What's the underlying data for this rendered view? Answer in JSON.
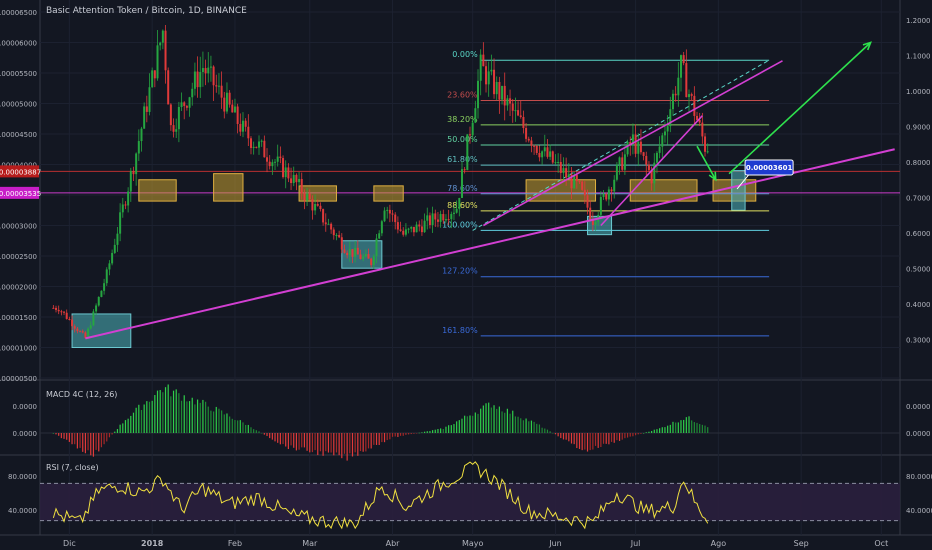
{
  "header": {
    "title": "Basic Attention Token / Bitcoin, 1D, BINANCE"
  },
  "colors": {
    "background": "#131722",
    "up": "#26a641",
    "down": "#e03a3a",
    "fib": "#5ad7c8",
    "trend": "#d23fd2",
    "hline_red": "#b73030",
    "hline_magenta": "#c93cc9",
    "arrow": "#2ee04d",
    "box_yellow": "#c8a030",
    "box_teal": "#4aa8b0",
    "rsi_line": "#f0e040"
  },
  "chart_data": [
    {
      "type": "line",
      "name": "price",
      "series_type": "candlestick",
      "ylim": [
        5e-06,
        6.5e-06
      ],
      "left_axis_ticks": [
        "0.00006500",
        "0.00006000",
        "0.00005500",
        "0.00005000",
        "0.00004500",
        "0.00004000",
        "0.00003500",
        "0.00003000",
        "0.00002500",
        "0.00002000",
        "0.00001500",
        "0.00001000",
        "0.00000500"
      ],
      "right_axis_ticks": [
        "1.2000",
        "1.1000",
        "1.0000",
        "0.9000",
        "0.8000",
        "0.7000",
        "0.6000",
        "0.5000",
        "0.4000",
        "0.3000"
      ],
      "x_tick_labels": [
        "Dic",
        "2018",
        "Feb",
        "Mar",
        "Abr",
        "Mayo",
        "Jun",
        "Jul",
        "Ago",
        "Sep",
        "Oct"
      ],
      "price_labels": [
        {
          "text": "0.00003887",
          "value": 3.887e-05
        },
        {
          "text": "0.00003535",
          "value": 3.535e-05
        }
      ],
      "callout": "0.00003601",
      "fib_levels": [
        {
          "label": "0.00%",
          "value": 5.71e-05
        },
        {
          "label": "23.60%",
          "value": 5.05e-05
        },
        {
          "label": "38.20%",
          "value": 4.65e-05
        },
        {
          "label": "50.00%",
          "value": 4.32e-05
        },
        {
          "label": "61.80%",
          "value": 3.99e-05
        },
        {
          "label": "78.60%",
          "value": 3.52e-05
        },
        {
          "label": "88.60%",
          "value": 3.24e-05
        },
        {
          "label": "100.00%",
          "value": 2.92e-05
        },
        {
          "label": "127.20%",
          "value": 2.16e-05
        },
        {
          "label": "161.80%",
          "value": 1.19e-05
        }
      ],
      "anchors": [
        {
          "date": "2017-11-27",
          "value": 1.65e-05
        },
        {
          "date": "2017-12-07",
          "value": 1.15e-05
        },
        {
          "date": "2017-12-15",
          "value": 2.2e-05
        },
        {
          "date": "2017-12-25",
          "value": 4e-05
        },
        {
          "date": "2018-01-05",
          "value": 6.2e-05
        },
        {
          "date": "2018-01-08",
          "value": 4.6e-05
        },
        {
          "date": "2018-01-20",
          "value": 5.6e-05
        },
        {
          "date": "2018-02-05",
          "value": 4.5e-05
        },
        {
          "date": "2018-02-22",
          "value": 3.8e-05
        },
        {
          "date": "2018-03-15",
          "value": 2.6e-05
        },
        {
          "date": "2018-03-24",
          "value": 2.4e-05
        },
        {
          "date": "2018-03-29",
          "value": 3.35e-05
        },
        {
          "date": "2018-04-05",
          "value": 2.85e-05
        },
        {
          "date": "2018-04-25",
          "value": 3.3e-05
        },
        {
          "date": "2018-05-04",
          "value": 5.6e-05
        },
        {
          "date": "2018-05-25",
          "value": 4.3e-05
        },
        {
          "date": "2018-06-10",
          "value": 3.6e-05
        },
        {
          "date": "2018-06-15",
          "value": 3.1e-05
        },
        {
          "date": "2018-06-30",
          "value": 4.4e-05
        },
        {
          "date": "2018-07-07",
          "value": 3.8e-05
        },
        {
          "date": "2018-07-18",
          "value": 5.6e-05
        },
        {
          "date": "2018-07-27",
          "value": 4.3e-05
        }
      ],
      "horizontal_lines": [
        3.887e-05,
        3.535e-05
      ],
      "trendlines": [
        {
          "from": [
            "2017-12-07",
            1.15e-05
          ],
          "to": [
            "2018-10-06",
            4.25e-05
          ]
        },
        {
          "from": [
            "2018-06-18",
            3e-05
          ],
          "to": [
            "2018-07-26",
            4.8e-05
          ]
        },
        {
          "from": [
            "2018-05-05",
            3e-05
          ],
          "to": [
            "2018-08-25",
            5.7e-05
          ]
        }
      ],
      "arrows": [
        {
          "from": [
            "2018-07-24",
            4.3e-05
          ],
          "to": [
            "2018-07-31",
            3.75e-05
          ]
        },
        {
          "from": [
            "2018-08-05",
            3.85e-05
          ],
          "to": [
            "2018-09-27",
            6e-05
          ]
        }
      ],
      "zones": [
        {
          "kind": "yellow",
          "from": [
            "2017-12-27",
            3.75e-05
          ],
          "to": [
            "2018-01-10",
            3.4e-05
          ]
        },
        {
          "kind": "yellow",
          "from": [
            "2018-01-24",
            3.85e-05
          ],
          "to": [
            "2018-02-04",
            3.4e-05
          ]
        },
        {
          "kind": "yellow",
          "from": [
            "2018-02-25",
            3.65e-05
          ],
          "to": [
            "2018-03-11",
            3.4e-05
          ]
        },
        {
          "kind": "yellow",
          "from": [
            "2018-03-25",
            3.65e-05
          ],
          "to": [
            "2018-04-05",
            3.4e-05
          ]
        },
        {
          "kind": "yellow",
          "from": [
            "2018-05-21",
            3.75e-05
          ],
          "to": [
            "2018-06-16",
            3.4e-05
          ]
        },
        {
          "kind": "yellow",
          "from": [
            "2018-06-29",
            3.75e-05
          ],
          "to": [
            "2018-07-24",
            3.4e-05
          ]
        },
        {
          "kind": "yellow",
          "from": [
            "2018-07-30",
            3.75e-05
          ],
          "to": [
            "2018-08-15",
            3.4e-05
          ]
        },
        {
          "kind": "teal",
          "from": [
            "2017-12-02",
            1.55e-05
          ],
          "to": [
            "2017-12-24",
            1e-05
          ]
        },
        {
          "kind": "teal",
          "from": [
            "2018-03-13",
            2.75e-05
          ],
          "to": [
            "2018-03-28",
            2.3e-05
          ]
        },
        {
          "kind": "teal",
          "from": [
            "2018-06-13",
            3.15e-05
          ],
          "to": [
            "2018-06-22",
            2.85e-05
          ]
        },
        {
          "kind": "teal",
          "from": [
            "2018-08-06",
            3.9e-05
          ],
          "to": [
            "2018-08-11",
            3.25e-05
          ]
        }
      ]
    },
    {
      "type": "bar",
      "name": "MACD 4C (12, 26)",
      "axis_ticks": [
        "0.0000",
        "0.0000"
      ],
      "anchors": [
        {
          "date": "2017-11-25",
          "value": 0.0
        },
        {
          "date": "2017-12-10",
          "value": -0.5
        },
        {
          "date": "2017-12-22",
          "value": 0.3
        },
        {
          "date": "2018-01-05",
          "value": 1.0
        },
        {
          "date": "2018-01-22",
          "value": 0.6
        },
        {
          "date": "2018-02-05",
          "value": 0.2
        },
        {
          "date": "2018-02-20",
          "value": -0.3
        },
        {
          "date": "2018-03-15",
          "value": -0.55
        },
        {
          "date": "2018-04-01",
          "value": -0.1
        },
        {
          "date": "2018-04-20",
          "value": 0.1
        },
        {
          "date": "2018-05-08",
          "value": 0.65
        },
        {
          "date": "2018-05-25",
          "value": 0.2
        },
        {
          "date": "2018-06-12",
          "value": -0.4
        },
        {
          "date": "2018-06-28",
          "value": -0.1
        },
        {
          "date": "2018-07-10",
          "value": 0.1
        },
        {
          "date": "2018-07-20",
          "value": 0.35
        },
        {
          "date": "2018-07-28",
          "value": 0.15
        }
      ]
    },
    {
      "type": "line",
      "name": "RSI (7, close)",
      "axis_ticks": [
        "80.0000",
        "40.0000"
      ],
      "ylim": [
        20,
        95
      ],
      "levels": [
        70,
        30
      ],
      "anchors": [
        {
          "date": "2017-11-25",
          "value": 38
        },
        {
          "date": "2017-12-05",
          "value": 28
        },
        {
          "date": "2017-12-12",
          "value": 62
        },
        {
          "date": "2017-12-20",
          "value": 68
        },
        {
          "date": "2017-12-28",
          "value": 60
        },
        {
          "date": "2018-01-05",
          "value": 75
        },
        {
          "date": "2018-01-12",
          "value": 42
        },
        {
          "date": "2018-01-20",
          "value": 65
        },
        {
          "date": "2018-01-30",
          "value": 48
        },
        {
          "date": "2018-02-10",
          "value": 55
        },
        {
          "date": "2018-02-22",
          "value": 36
        },
        {
          "date": "2018-03-05",
          "value": 30
        },
        {
          "date": "2018-03-18",
          "value": 26
        },
        {
          "date": "2018-03-28",
          "value": 68
        },
        {
          "date": "2018-04-06",
          "value": 45
        },
        {
          "date": "2018-04-20",
          "value": 70
        },
        {
          "date": "2018-05-02",
          "value": 88
        },
        {
          "date": "2018-05-10",
          "value": 72
        },
        {
          "date": "2018-05-22",
          "value": 40
        },
        {
          "date": "2018-06-05",
          "value": 33
        },
        {
          "date": "2018-06-15",
          "value": 28
        },
        {
          "date": "2018-06-24",
          "value": 60
        },
        {
          "date": "2018-07-05",
          "value": 40
        },
        {
          "date": "2018-07-15",
          "value": 45
        },
        {
          "date": "2018-07-19",
          "value": 75
        },
        {
          "date": "2018-07-24",
          "value": 45
        },
        {
          "date": "2018-07-28",
          "value": 32
        }
      ]
    }
  ]
}
